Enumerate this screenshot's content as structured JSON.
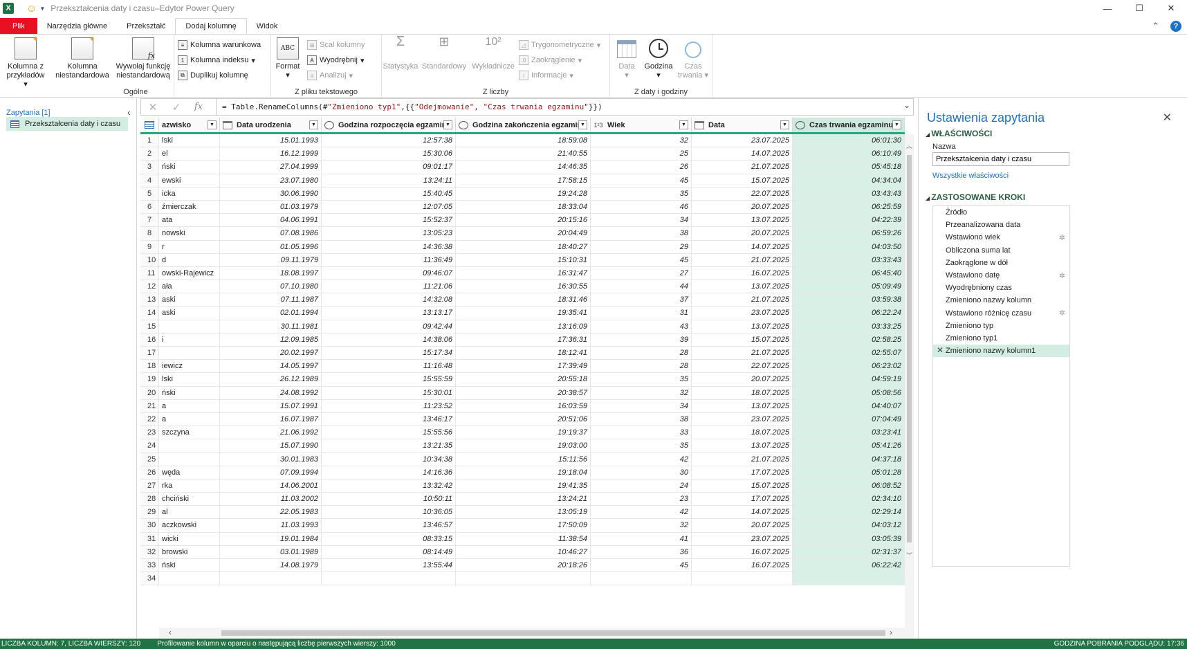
{
  "window": {
    "title": "Przekształcenia daty i czasu–Edytor Power Query",
    "app_icon": "X"
  },
  "tabs": [
    "Plik",
    "Narzędzia główne",
    "Przekształć",
    "Dodaj kolumnę",
    "Widok"
  ],
  "ribbon": {
    "general": {
      "label": "Ogólne",
      "col_from_examples": [
        "Kolumna z",
        "przykładów"
      ],
      "custom_column": [
        "Kolumna",
        "niestandardowa"
      ],
      "invoke_custom": [
        "Wywołaj funkcję",
        "niestandardową"
      ],
      "conditional_column": "Kolumna warunkowa",
      "index_column": "Kolumna indeksu",
      "duplicate_column": "Duplikuj kolumnę"
    },
    "from_text": {
      "label": "Z pliku tekstowego",
      "format": "Format",
      "merge_columns": "Scal kolumny",
      "extract": "Wyodrębnij",
      "parse": "Analizuj"
    },
    "from_number": {
      "label": "Z liczby",
      "statistics": "Statystyka",
      "standard": "Standardowy",
      "scientific": "Wykładnicze",
      "trigonometry": "Trygonometryczne",
      "rounding": "Zaokrąglenie",
      "information": "Informacje"
    },
    "from_datetime": {
      "label": "Z daty i godziny",
      "date": "Data",
      "time": "Godzina",
      "duration": [
        "Czas",
        "trwania"
      ]
    }
  },
  "queries": {
    "header": "Zapytania [1]",
    "items": [
      "Przekształcenia daty i czasu"
    ]
  },
  "formula": {
    "prefix": "= Table.RenameColumns(#",
    "str1": "\"Zmieniono typ1\"",
    "mid": ",{{",
    "str2": "\"Odejmowanie\"",
    "sep": ", ",
    "str3": "\"Czas trwania egzaminu\"",
    "suffix": "}})"
  },
  "grid": {
    "columns": [
      {
        "name": "azwisko",
        "type": "",
        "width": 88
      },
      {
        "name": "Data urodzenia",
        "type": "cal",
        "width": 147
      },
      {
        "name": "Godzina rozpoczęcia egzaminu",
        "type": "clk",
        "width": 194
      },
      {
        "name": "Godzina zakończenia egzaminu",
        "type": "clk",
        "width": 195
      },
      {
        "name": "Wiek",
        "type": "123",
        "width": 146
      },
      {
        "name": "Data",
        "type": "cal",
        "width": 146
      },
      {
        "name": "Czas trwania egzaminu",
        "type": "clk",
        "width": 162
      }
    ],
    "rows": [
      [
        "lski",
        "15.01.1993",
        "12:57:38",
        "18:59:08",
        "32",
        "23.07.2025",
        "06:01:30"
      ],
      [
        "el",
        "16.12.1999",
        "15:30:06",
        "21:40:55",
        "25",
        "14.07.2025",
        "06:10:49"
      ],
      [
        "ński",
        "27.04.1999",
        "09:01:17",
        "14:46:35",
        "26",
        "21.07.2025",
        "05:45:18"
      ],
      [
        "ewski",
        "23.07.1980",
        "13:24:11",
        "17:58:15",
        "45",
        "15.07.2025",
        "04:34:04"
      ],
      [
        "icka",
        "30.06.1990",
        "15:40:45",
        "19:24:28",
        "35",
        "22.07.2025",
        "03:43:43"
      ],
      [
        "źmierczak",
        "01.03.1979",
        "12:07:05",
        "18:33:04",
        "46",
        "20.07.2025",
        "06:25:59"
      ],
      [
        "ata",
        "04.06.1991",
        "15:52:37",
        "20:15:16",
        "34",
        "13.07.2025",
        "04:22:39"
      ],
      [
        "nowski",
        "07.08.1986",
        "13:05:23",
        "20:04:49",
        "38",
        "20.07.2025",
        "06:59:26"
      ],
      [
        "r",
        "01.05.1996",
        "14:36:38",
        "18:40:27",
        "29",
        "14.07.2025",
        "04:03:50"
      ],
      [
        "d",
        "09.11.1979",
        "11:36:49",
        "15:10:31",
        "45",
        "21.07.2025",
        "03:33:43"
      ],
      [
        "owski-Rajewicz",
        "18.08.1997",
        "09:46:07",
        "16:31:47",
        "27",
        "16.07.2025",
        "06:45:40"
      ],
      [
        "ała",
        "07.10.1980",
        "11:21:06",
        "16:30:55",
        "44",
        "13.07.2025",
        "05:09:49"
      ],
      [
        "aski",
        "07.11.1987",
        "14:32:08",
        "18:31:46",
        "37",
        "21.07.2025",
        "03:59:38"
      ],
      [
        "aski",
        "02.01.1994",
        "13:13:17",
        "19:35:41",
        "31",
        "23.07.2025",
        "06:22:24"
      ],
      [
        "",
        "30.11.1981",
        "09:42:44",
        "13:16:09",
        "43",
        "13.07.2025",
        "03:33:25"
      ],
      [
        "i",
        "12.09.1985",
        "14:38:06",
        "17:36:31",
        "39",
        "15.07.2025",
        "02:58:25"
      ],
      [
        "",
        "20.02.1997",
        "15:17:34",
        "18:12:41",
        "28",
        "21.07.2025",
        "02:55:07"
      ],
      [
        "iewicz",
        "14.05.1997",
        "11:16:48",
        "17:39:49",
        "28",
        "22.07.2025",
        "06:23:02"
      ],
      [
        "lski",
        "26.12.1989",
        "15:55:59",
        "20:55:18",
        "35",
        "20.07.2025",
        "04:59:19"
      ],
      [
        "ński",
        "24.08.1992",
        "15:30:01",
        "20:38:57",
        "32",
        "18.07.2025",
        "05:08:56"
      ],
      [
        "a",
        "15.07.1991",
        "11:23:52",
        "16:03:59",
        "34",
        "13.07.2025",
        "04:40:07"
      ],
      [
        "a",
        "16.07.1987",
        "13:46:17",
        "20:51:06",
        "38",
        "23.07.2025",
        "07:04:49"
      ],
      [
        "szczyna",
        "21.06.1992",
        "15:55:56",
        "19:19:37",
        "33",
        "18.07.2025",
        "03:23:41"
      ],
      [
        "",
        "15.07.1990",
        "13:21:35",
        "19:03:00",
        "35",
        "13.07.2025",
        "05:41:26"
      ],
      [
        "",
        "30.01.1983",
        "10:34:38",
        "15:11:56",
        "42",
        "21.07.2025",
        "04:37:18"
      ],
      [
        "węda",
        "07.09.1994",
        "14:16:36",
        "19:18:04",
        "30",
        "17.07.2025",
        "05:01:28"
      ],
      [
        "rka",
        "14.06.2001",
        "13:32:42",
        "19:41:35",
        "24",
        "15.07.2025",
        "06:08:52"
      ],
      [
        "chciński",
        "11.03.2002",
        "10:50:11",
        "13:24:21",
        "23",
        "17.07.2025",
        "02:34:10"
      ],
      [
        "al",
        "22.05.1983",
        "10:36:05",
        "13:05:19",
        "42",
        "14.07.2025",
        "02:29:14"
      ],
      [
        "aczkowski",
        "11.03.1993",
        "13:46:57",
        "17:50:09",
        "32",
        "20.07.2025",
        "04:03:12"
      ],
      [
        "wicki",
        "19.01.1984",
        "08:33:15",
        "11:38:54",
        "41",
        "23.07.2025",
        "03:05:39"
      ],
      [
        "browski",
        "03.01.1989",
        "08:14:49",
        "10:46:27",
        "36",
        "16.07.2025",
        "02:31:37"
      ],
      [
        "ński",
        "14.08.1979",
        "13:55:44",
        "20:18:26",
        "45",
        "16.07.2025",
        "06:22:42"
      ],
      [
        "",
        "",
        "",
        "",
        "",
        "",
        ""
      ]
    ]
  },
  "settings": {
    "title": "Ustawienia zapytania",
    "properties_header": "WŁAŚCIWOŚCI",
    "name_label": "Nazwa",
    "name_value": "Przekształcenia daty i czasu",
    "all_properties": "Wszystkie właściwości",
    "steps_header": "ZASTOSOWANE KROKI",
    "steps": [
      {
        "label": "Źródło",
        "gear": false
      },
      {
        "label": "Przeanalizowana data",
        "gear": false
      },
      {
        "label": "Wstawiono wiek",
        "gear": true
      },
      {
        "label": "Obliczona suma lat",
        "gear": false
      },
      {
        "label": "Zaokrąglone w dół",
        "gear": false
      },
      {
        "label": "Wstawiono datę",
        "gear": true
      },
      {
        "label": "Wyodrębniony czas",
        "gear": false
      },
      {
        "label": "Zmieniono nazwy kolumn",
        "gear": false
      },
      {
        "label": "Wstawiono różnicę czasu",
        "gear": true
      },
      {
        "label": "Zmieniono typ",
        "gear": false
      },
      {
        "label": "Zmieniono typ1",
        "gear": false
      },
      {
        "label": "Zmieniono nazwy kolumn1",
        "gear": false,
        "active": true
      }
    ]
  },
  "status": {
    "left": "LICZBA KOLUMN: 7, LICZBA WIERSZY: 120",
    "middle": "Profilowanie kolumn w oparciu o następującą liczbę pierwszych wierszy: 1000",
    "right": "GODZINA POBRANIA PODGLĄDU: 17:36"
  },
  "colors": {
    "accent": "#217346",
    "file_tab": "#e81123",
    "selected": "#d3ede3",
    "link": "#1a73c9"
  }
}
